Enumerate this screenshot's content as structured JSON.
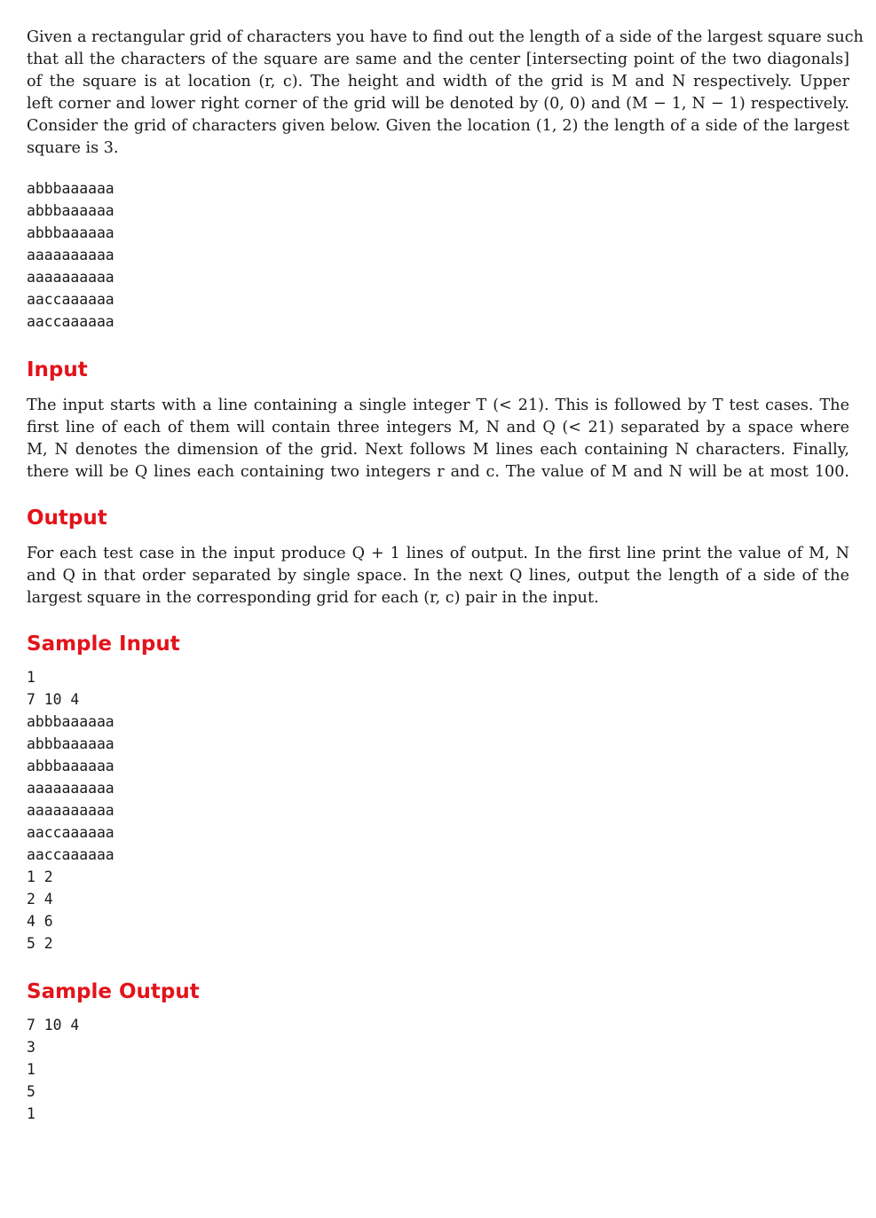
{
  "intro": {
    "lines": [
      "Given a rectangular grid of characters you have to find out the length of a side of the largest square such",
      "that all the characters of the square are same and the center [intersecting point of the two diagonals]",
      "of the square is at location (r, c). The height and width of the grid is M and N respectively. Upper",
      "left corner and lower right corner of the grid will be denoted by (0, 0) and (M − 1, N − 1) respectively.",
      "Consider the grid of characters given below. Given the location (1, 2) the length of a side of the largest",
      "square is 3."
    ],
    "grid": [
      "abbbaaaaaa",
      "abbbaaaaaa",
      "abbbaaaaaa",
      "aaaaaaaaaa",
      "aaaaaaaaaa",
      "aaccaaaaaa",
      "aaccaaaaaa"
    ]
  },
  "input_section": {
    "heading": "Input",
    "lines": [
      "The input starts with a line containing a single integer T (< 21). This is followed by T test cases. The",
      "first line of each of them will contain three integers M, N and Q (< 21) separated by a space where",
      "M, N denotes the dimension of the grid. Next follows M lines each containing N characters. Finally,",
      "there will be Q lines each containing two integers r and c. The value of M and N will be at most 100."
    ]
  },
  "output_section": {
    "heading": "Output",
    "lines": [
      "For each test case in the input produce Q + 1 lines of output. In the first line print the value of M, N",
      "and Q in that order separated by single space. In the next Q lines, output the length of a side of the",
      "largest square in the corresponding grid for each (r, c) pair in the input."
    ]
  },
  "sample_input": {
    "heading": "Sample Input",
    "lines": [
      "1",
      "7 10 4",
      "abbbaaaaaa",
      "abbbaaaaaa",
      "abbbaaaaaa",
      "aaaaaaaaaa",
      "aaaaaaaaaa",
      "aaccaaaaaa",
      "aaccaaaaaa",
      "1 2",
      "2 4",
      "4 6",
      "5 2"
    ]
  },
  "sample_output": {
    "heading": "Sample Output",
    "lines": [
      "7 10 4",
      "3",
      "1",
      "5",
      "1"
    ]
  }
}
